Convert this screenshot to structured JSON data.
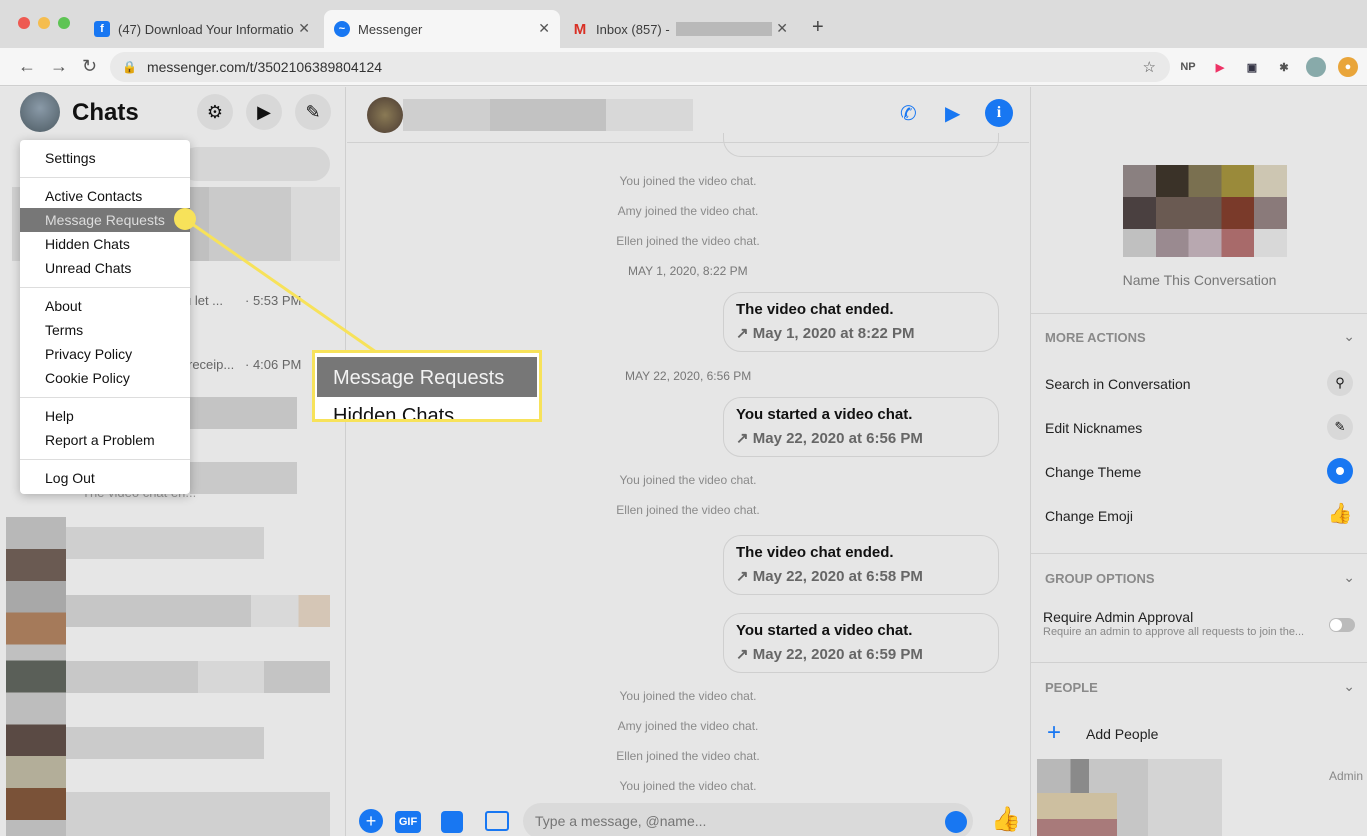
{
  "browser": {
    "tabs": [
      {
        "title": "(47) Download Your Informatio",
        "icon": "facebook-icon"
      },
      {
        "title": "Messenger",
        "icon": "messenger-icon"
      },
      {
        "title": "Inbox (857) -",
        "icon": "gmail-icon"
      }
    ],
    "url": "messenger.com/t/3502106389804124",
    "extension_label": "NP",
    "new_tab": "+",
    "close": "✕"
  },
  "sidebar": {
    "title": "Chats",
    "rows": [
      {
        "snippet": "u let ...",
        "time": "· 5:53 PM"
      },
      {
        "snippet": "receip...",
        "time": "· 4:06 PM"
      },
      {
        "snippet": "The video chat en..."
      }
    ]
  },
  "menu": {
    "items": [
      "Settings",
      "Active Contacts",
      "Message Requests",
      "Hidden Chats",
      "Unread Chats",
      "About",
      "Terms",
      "Privacy Policy",
      "Cookie Policy",
      "Help",
      "Report a Problem",
      "Log Out"
    ],
    "highlighted": "Message Requests"
  },
  "callout": {
    "label": "Message Requests",
    "next_label": "Hidden Chats"
  },
  "conversation": {
    "system_1": [
      "You joined the video chat.",
      "Amy joined the video chat.",
      "Ellen joined the video chat."
    ],
    "stamp_1": "MAY 1, 2020, 8:22 PM",
    "bubble_1": {
      "title": "The video chat ended.",
      "sub": "↗ May 1, 2020 at 8:22 PM"
    },
    "stamp_2": "MAY 22, 2020, 6:56 PM",
    "bubble_2": {
      "title": "You started a video chat.",
      "sub": "↗ May 22, 2020 at 6:56 PM"
    },
    "system_2": [
      "You joined the video chat.",
      "Ellen joined the video chat."
    ],
    "bubble_3": {
      "title": "The video chat ended.",
      "sub": "↗ May 22, 2020 at 6:58 PM"
    },
    "bubble_4": {
      "title": "You started a video chat.",
      "sub": "↗ May 22, 2020 at 6:59 PM"
    },
    "system_3": [
      "You joined the video chat.",
      "Amy joined the video chat.",
      "Ellen joined the video chat.",
      "You joined the video chat."
    ],
    "composer_placeholder": "Type a message, @name...",
    "gif_label": "GIF"
  },
  "info_panel": {
    "name_prompt": "Name This Conversation",
    "more_actions": "MORE ACTIONS",
    "actions": [
      "Search in Conversation",
      "Edit Nicknames",
      "Change Theme",
      "Change Emoji"
    ],
    "group_options": "GROUP OPTIONS",
    "require_admin": "Require Admin Approval",
    "require_admin_desc": "Require an admin to approve all requests to join the...",
    "people": "PEOPLE",
    "add_people": "Add People",
    "admin_label": "Admin"
  },
  "colors": {
    "accent": "#1877f2",
    "callout": "#f7e25a",
    "menu_highlight": "#777777"
  }
}
